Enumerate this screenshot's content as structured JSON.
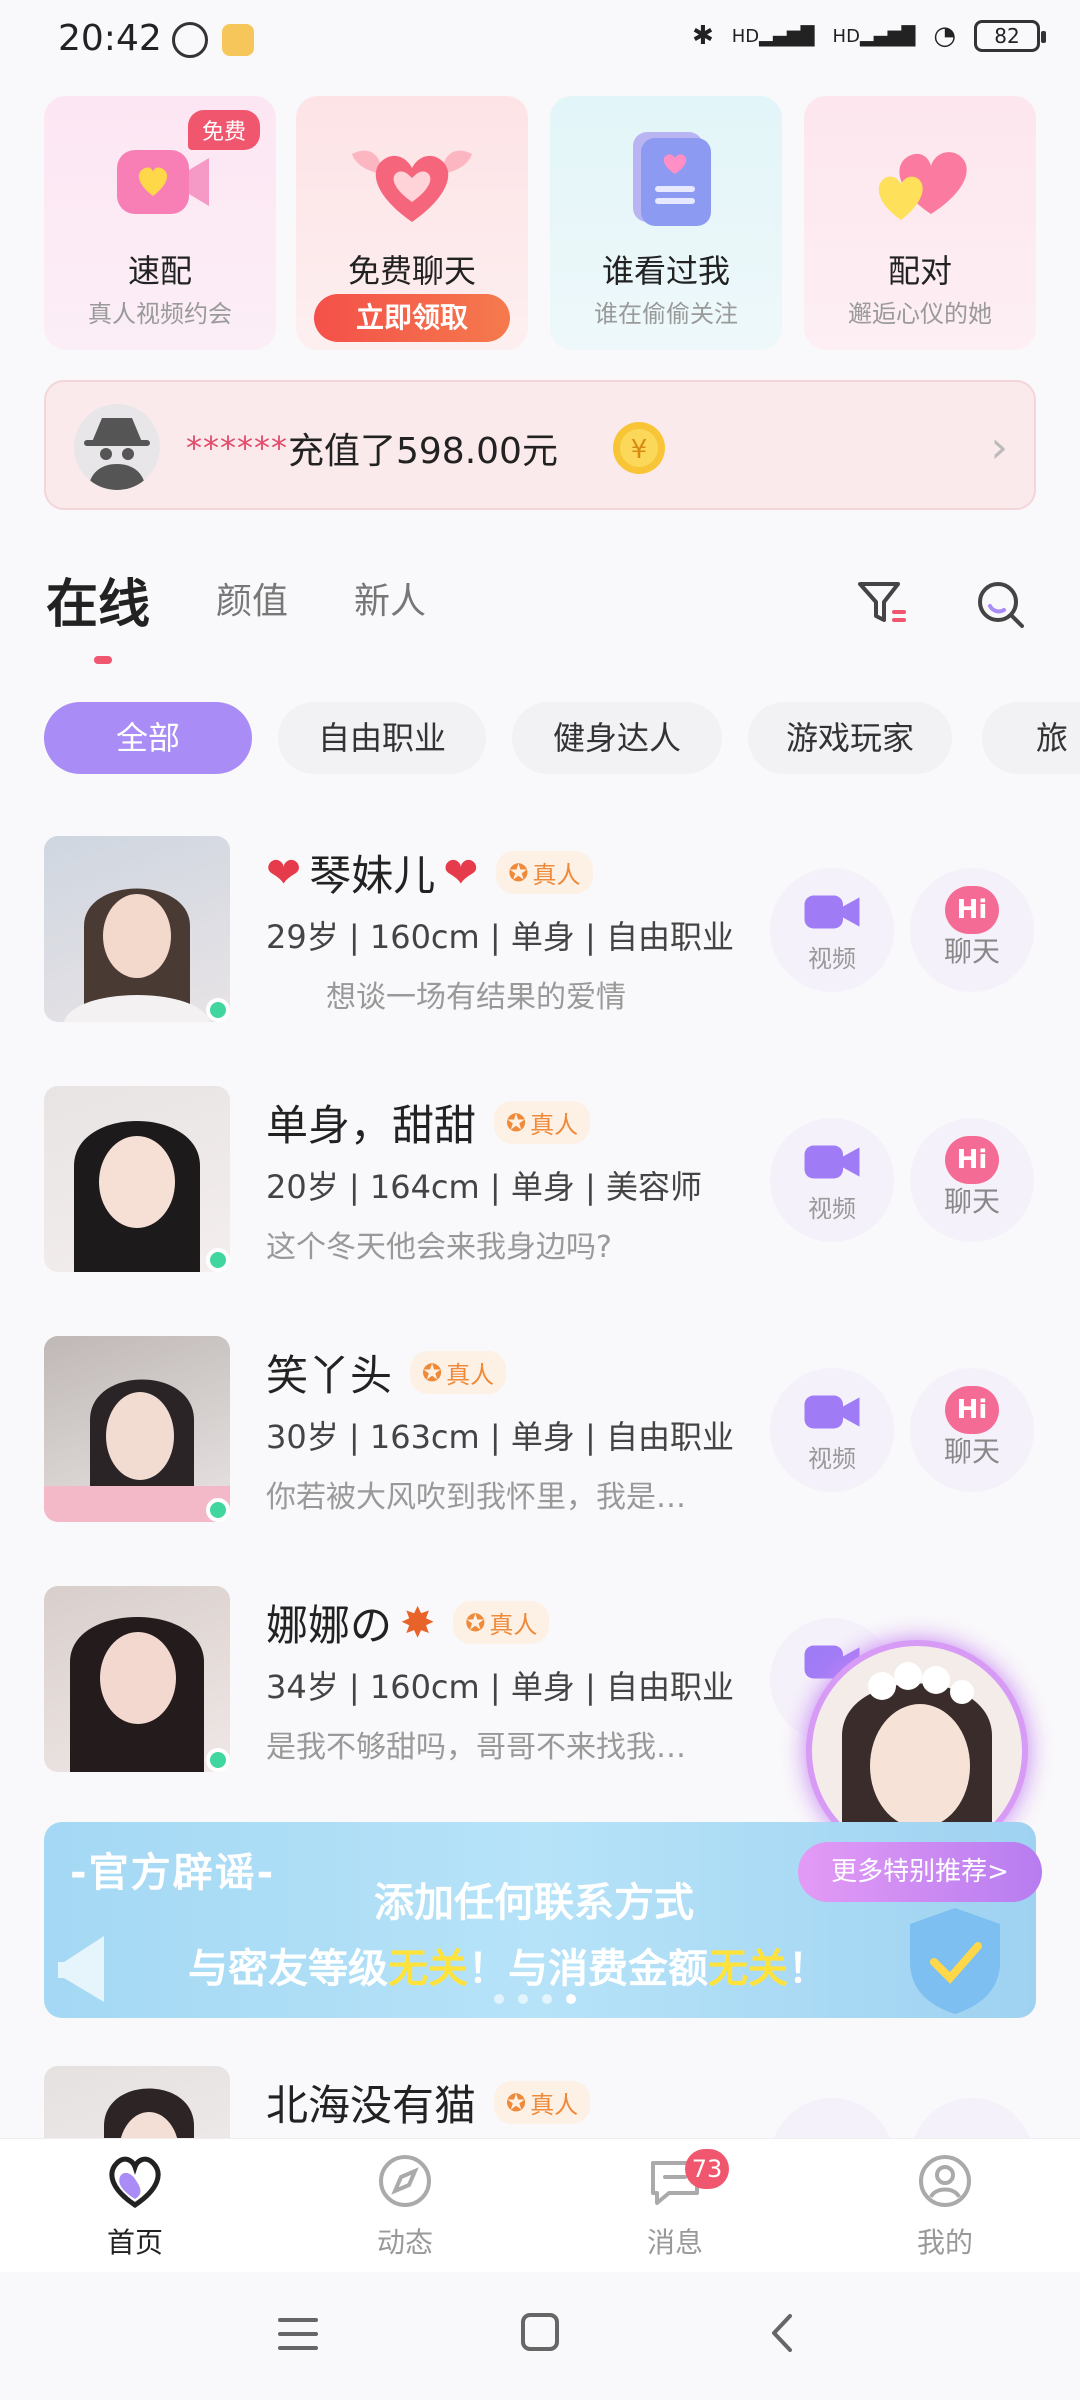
{
  "status_bar": {
    "time": "20:42",
    "hd1": "HD",
    "hd2": "HD",
    "battery": "82"
  },
  "feature_cards": [
    {
      "title": "速配",
      "subtitle": "真人视频约会",
      "badge": "免费"
    },
    {
      "title": "免费聊天",
      "button": "立即领取"
    },
    {
      "title": "谁看过我",
      "subtitle": "谁在偷偷关注"
    },
    {
      "title": "配对",
      "subtitle": "邂逅心仪的她"
    }
  ],
  "recharge": {
    "masked_user": "******",
    "text": "充值了598.00元"
  },
  "tabs": [
    "在线",
    "颜值",
    "新人"
  ],
  "chips": [
    "全部",
    "自由职业",
    "健身达人",
    "游戏玩家",
    "旅行"
  ],
  "real_label": "真人",
  "users": [
    {
      "name": "琴妹儿",
      "info": "29岁 | 160cm | 单身 | 自由职业",
      "desc": "想谈一场有结果的爱情"
    },
    {
      "name": "单身，甜甜",
      "info": "20岁 | 164cm | 单身 | 美容师",
      "desc": "这个冬天他会来我身边吗?"
    },
    {
      "name": "笑丫头",
      "info": "30岁 | 163cm | 单身 | 自由职业",
      "desc": "你若被大风吹到我怀里，我是…"
    },
    {
      "name": "娜娜の",
      "info": "34岁 | 160cm | 单身 | 自由职业",
      "desc": "是我不够甜吗，哥哥不来找我…"
    },
    {
      "name": "北海没有猫"
    }
  ],
  "actions": {
    "video": "视频",
    "chat": "聊天",
    "hi": "Hi"
  },
  "banner": {
    "official": "-官方辟谣-",
    "line1": "添加任何联系方式",
    "line2_a": "与密友等级",
    "line2_b": "无关",
    "line2_c": "！与消费金额",
    "line2_d": "无关",
    "line2_e": "！",
    "more": "更多特别推荐>"
  },
  "bottom_nav": [
    {
      "label": "首页",
      "icon": "home-heart-icon"
    },
    {
      "label": "动态",
      "icon": "compass-icon"
    },
    {
      "label": "消息",
      "icon": "message-icon",
      "badge": "73"
    },
    {
      "label": "我的",
      "icon": "profile-icon"
    }
  ],
  "colors": {
    "accent": "#a98cf5",
    "pink": "#f0566e",
    "online": "#41d69e",
    "real_badge": "#ee8a3a"
  }
}
